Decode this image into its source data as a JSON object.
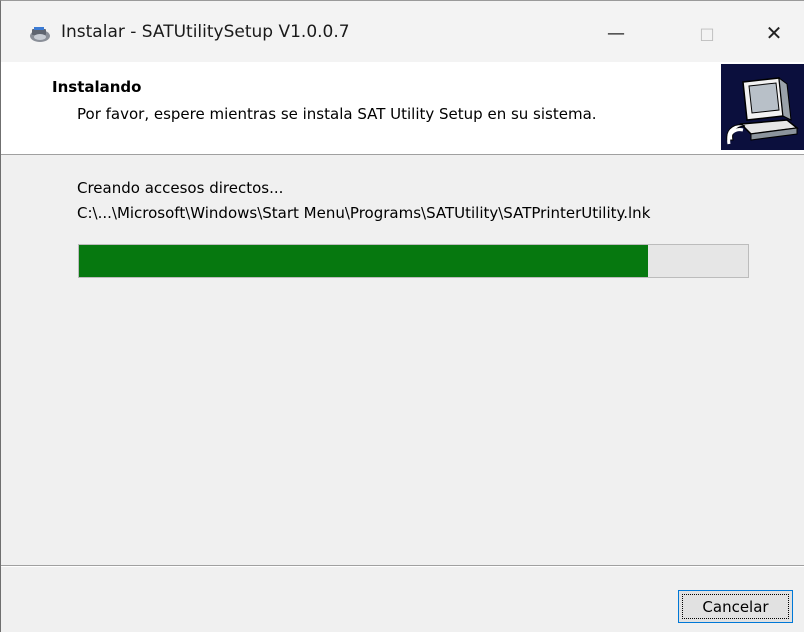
{
  "window": {
    "title": "Instalar - SATUtilitySetup V1.0.0.7",
    "minimize_glyph": "—",
    "maximize_glyph": "□",
    "close_glyph": "✕"
  },
  "header": {
    "title": "Instalando",
    "description": "Por favor, espere mientras se instala SAT Utility Setup en su sistema."
  },
  "progress": {
    "status": "Creando accesos directos...",
    "filename": "C:\\...\\Microsoft\\Windows\\Start Menu\\Programs\\SATUtility\\SATPrinterUtility.lnk",
    "percent": 85,
    "fill_color": "#06780f"
  },
  "footer": {
    "cancel_label": "Cancelar"
  },
  "icons": {
    "app_icon": "installer-icon",
    "wizard_image": "computer-installer-icon"
  }
}
